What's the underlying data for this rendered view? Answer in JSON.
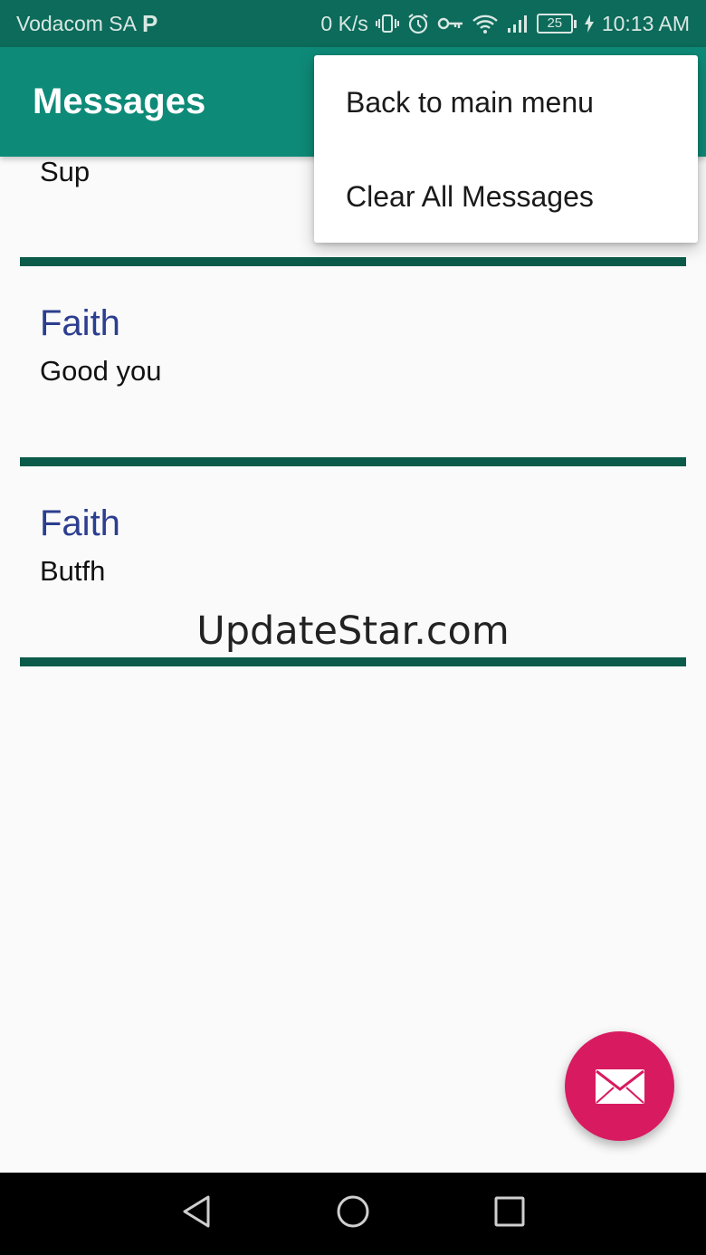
{
  "status_bar": {
    "carrier": "Vodacom SA",
    "carrier_badge": "P",
    "network_speed": "0 K/s",
    "battery_level": "25",
    "time": "10:13 AM",
    "icons": [
      "vibrate-icon",
      "alarm-icon",
      "vpn-key-icon",
      "wifi-icon",
      "signal-icon",
      "battery-icon",
      "charging-icon"
    ]
  },
  "app_bar": {
    "title": "Messages"
  },
  "overflow_menu": {
    "items": [
      {
        "label": "Back to main menu"
      },
      {
        "label": "Clear All Messages"
      }
    ]
  },
  "messages": [
    {
      "sender": "",
      "body": "Sup"
    },
    {
      "sender": "Faith",
      "body": "Good you"
    },
    {
      "sender": "Faith",
      "body": "Butfh"
    }
  ],
  "watermark": "UpdateStar.com",
  "fab": {
    "icon": "mail-icon"
  },
  "nav_bar": {
    "icons": [
      "back-icon",
      "home-icon",
      "recents-icon"
    ]
  },
  "colors": {
    "status_bar": "#0c6b5a",
    "app_bar": "#0e8a78",
    "divider": "#0b5a4a",
    "sender_text": "#2c3e8f",
    "fab": "#d81b60"
  }
}
